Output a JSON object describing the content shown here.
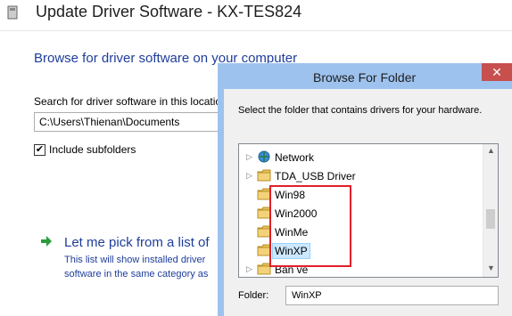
{
  "wizard": {
    "title": "Update Driver Software - KX-TES824",
    "heading": "Browse for driver software on your computer",
    "search_label": "Search for driver software in this locatio",
    "path_value": "C:\\Users\\Thienan\\Documents",
    "include_subfolders_label": "Include subfolders",
    "include_subfolders_checked": "✔",
    "pick_link": "Let me pick from a list of",
    "pick_desc_line1": "This list will show installed driver",
    "pick_desc_line2": "software in the same category as"
  },
  "dialog": {
    "title": "Browse For Folder",
    "close_glyph": "✕",
    "instruction": "Select the folder that contains drivers for your hardware.",
    "tree_items": [
      {
        "label": "Network",
        "icon": "network-icon",
        "expander": "▷"
      },
      {
        "label": "TDA_USB Driver",
        "icon": "folder-icon",
        "expander": "▷"
      },
      {
        "label": "Win98",
        "icon": "folder-icon",
        "expander": ""
      },
      {
        "label": "Win2000",
        "icon": "folder-icon",
        "expander": ""
      },
      {
        "label": "WinMe",
        "icon": "folder-icon",
        "expander": ""
      },
      {
        "label": "WinXP",
        "icon": "folder-icon",
        "expander": "",
        "selected": true
      },
      {
        "label": "Bản vẽ",
        "icon": "folder-icon",
        "expander": "▷"
      }
    ],
    "scroll_up_glyph": "▲",
    "scroll_down_glyph": "▼",
    "folder_label": "Folder:",
    "folder_value": "WinXP"
  },
  "colors": {
    "accent_link": "#1f3d9b",
    "highlight_box": "#e0202a",
    "dialog_frame": "#9dc2ee",
    "close_button": "#c7504f",
    "selection": "#cce8ff"
  }
}
